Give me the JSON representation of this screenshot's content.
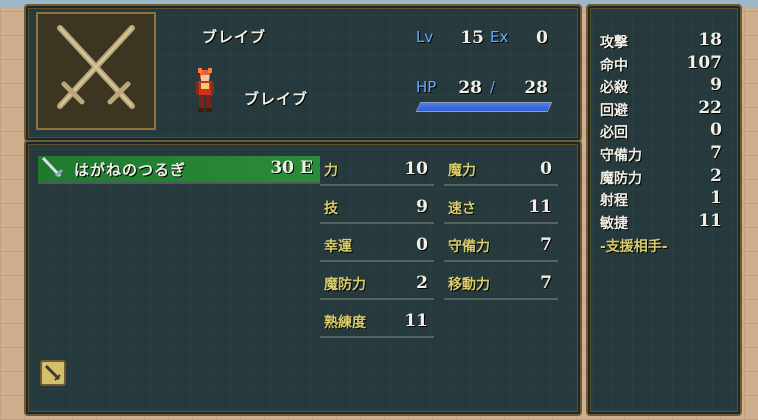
{
  "unit": {
    "class_name": "ブレイブ",
    "name": "ブレイブ",
    "lv_label": "Lv",
    "lv": "15",
    "ex_label": "Ex",
    "ex": "0",
    "hp_label": "HP",
    "hp_current": "28",
    "hp_sep": "/",
    "hp_max": "28",
    "hp_fill": 1.0
  },
  "inventory": {
    "items": [
      {
        "name": "はがねのつるぎ",
        "uses": "30",
        "equip": "E",
        "icon": "sword-icon"
      }
    ],
    "bottom_icon": "sword-icon"
  },
  "stats": [
    {
      "label": "力",
      "value": "10"
    },
    {
      "label": "魔力",
      "value": "0"
    },
    {
      "label": "技",
      "value": "9"
    },
    {
      "label": "速さ",
      "value": "11"
    },
    {
      "label": "幸運",
      "value": "0"
    },
    {
      "label": "守備力",
      "value": "7"
    },
    {
      "label": "魔防力",
      "value": "2"
    },
    {
      "label": "移動力",
      "value": "7"
    },
    {
      "label": "熟練度",
      "value": "11"
    }
  ],
  "combat": [
    {
      "label": "攻撃",
      "value": "18"
    },
    {
      "label": "命中",
      "value": "107"
    },
    {
      "label": "必殺",
      "value": "9"
    },
    {
      "label": "回避",
      "value": "22"
    },
    {
      "label": "必回",
      "value": "0"
    },
    {
      "label": "守備力",
      "value": "7"
    },
    {
      "label": "魔防力",
      "value": "2"
    },
    {
      "label": "射程",
      "value": "1"
    },
    {
      "label": "敏捷",
      "value": "11"
    }
  ],
  "support_label": "-支援相手-",
  "colors": {
    "panel": "#263a3d",
    "border": "#6e5a33",
    "item_highlight": "#1f7a2e",
    "hp_bar": "#2d5ccf",
    "tag_blue": "#6aa8ff"
  }
}
